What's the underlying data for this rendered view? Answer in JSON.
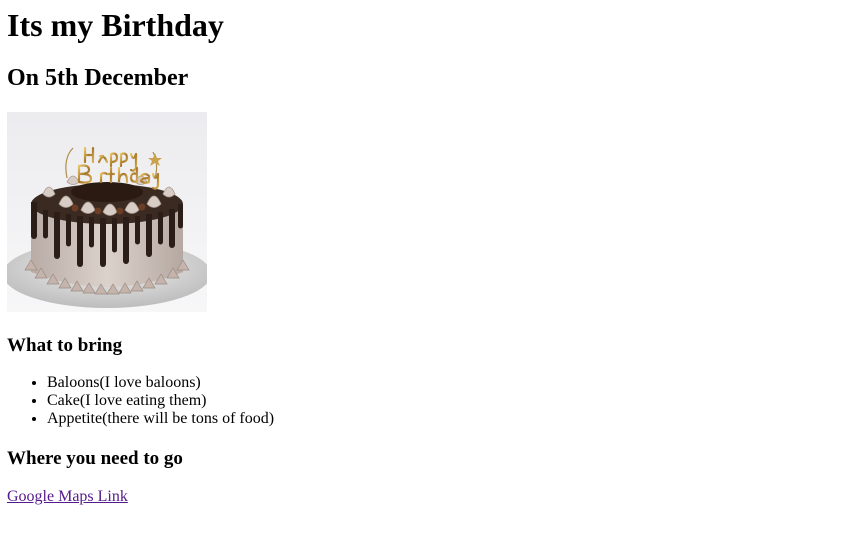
{
  "page": {
    "title": "Its my Birthday",
    "subtitle": "On 5th December"
  },
  "bring": {
    "heading": "What to bring",
    "items": [
      "Baloons(I love baloons)",
      "Cake(I love eating them)",
      "Appetite(there will be tons of food)"
    ]
  },
  "where": {
    "heading": "Where you need to go",
    "link_text": "Google Maps Link"
  },
  "cake_image": {
    "topper_text": "Happy Birthday"
  },
  "colors": {
    "link_visited": "#551a8b"
  }
}
